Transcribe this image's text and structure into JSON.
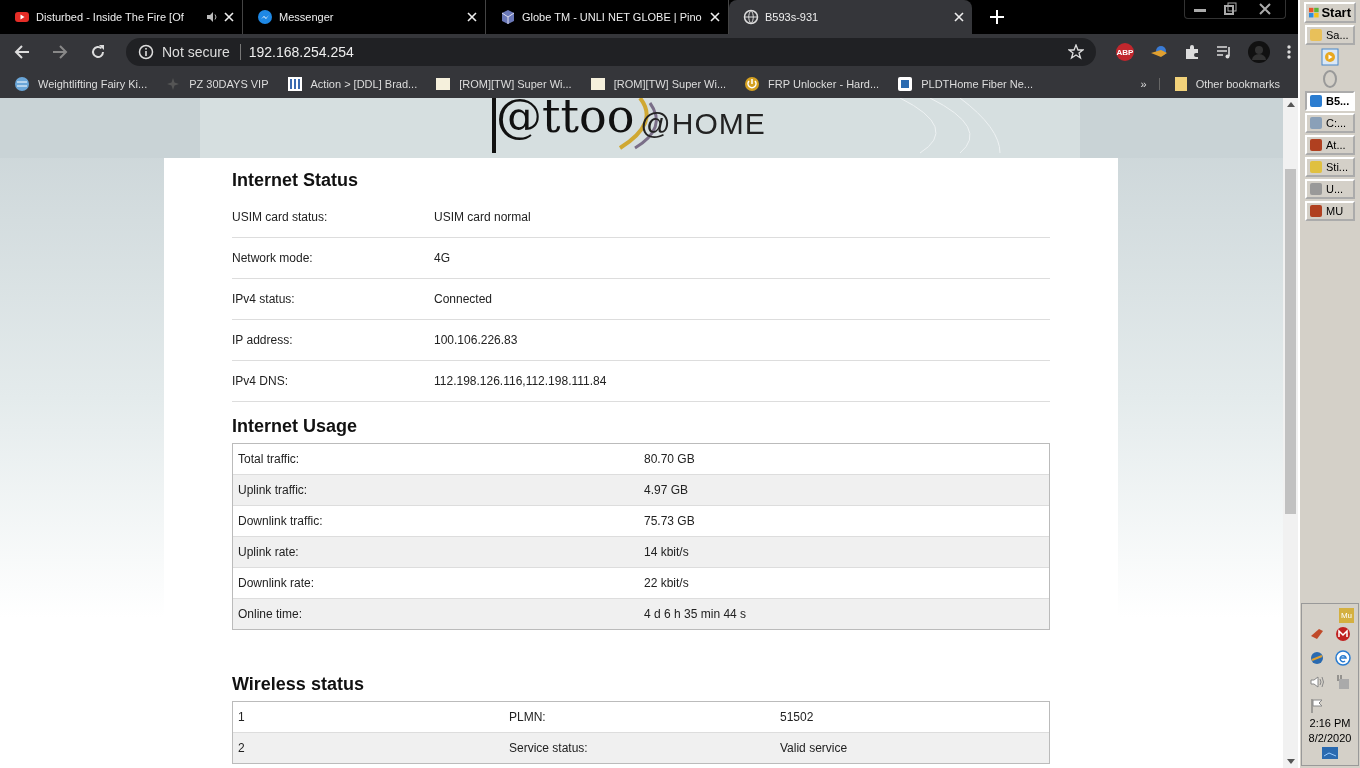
{
  "browser": {
    "tabs": [
      {
        "title": "Disturbed - Inside The Fire [Of",
        "audio": true,
        "selected": false
      },
      {
        "title": "Messenger",
        "audio": false,
        "selected": false
      },
      {
        "title": "Globe TM - UNLI NET GLOBE | Pino",
        "audio": false,
        "selected": false
      },
      {
        "title": "B593s-931",
        "audio": false,
        "selected": true
      }
    ],
    "security": "Not secure",
    "address": "192.168.254.254",
    "extensions": [
      {
        "label": "ABP"
      }
    ],
    "bookmarks": [
      {
        "title": "Weightlifting Fairy Ki..."
      },
      {
        "title": "PZ 30DAYS VIP"
      },
      {
        "title": "Action > [DDL] Brad..."
      },
      {
        "title": "[ROM][TW] Super Wi..."
      },
      {
        "title": "[ROM][TW] Super Wi..."
      },
      {
        "title": "FRP Unlocker - Hard..."
      },
      {
        "title": "PLDTHome Fiber Ne..."
      }
    ],
    "more_bookmarks": "»",
    "other_bookmarks": "Other bookmarks"
  },
  "page": {
    "logo": {
      "brand": "@ttoo",
      "suffix": "@HOME"
    },
    "internet_status": {
      "title": "Internet Status",
      "rows": [
        {
          "label": "USIM card status:",
          "value": "USIM card normal"
        },
        {
          "label": "Network mode:",
          "value": "4G"
        },
        {
          "label": "IPv4 status:",
          "value": "Connected"
        },
        {
          "label": "IP address:",
          "value": "100.106.226.83"
        },
        {
          "label": "IPv4 DNS:",
          "value": "112.198.126.116,112.198.111.84"
        }
      ]
    },
    "internet_usage": {
      "title": "Internet Usage",
      "rows": [
        {
          "label": "Total traffic:",
          "value": "80.70 GB"
        },
        {
          "label": "Uplink traffic:",
          "value": "4.97 GB"
        },
        {
          "label": "Downlink traffic:",
          "value": "75.73 GB"
        },
        {
          "label": "Uplink rate:",
          "value": "14 kbit/s"
        },
        {
          "label": "Downlink rate:",
          "value": "22 kbit/s"
        },
        {
          "label": "Online time:",
          "value": "4 d 6 h 35 min 44 s"
        }
      ]
    },
    "wireless_status": {
      "title": "Wireless status",
      "rows": [
        {
          "index": "1",
          "label": "PLMN:",
          "value": "51502"
        },
        {
          "index": "2",
          "label": "Service status:",
          "value": "Valid service"
        }
      ]
    }
  },
  "taskbar": {
    "start": "Start",
    "tasks": [
      {
        "title": "Sa...",
        "selected": false
      },
      {
        "title": "B5...",
        "selected": true
      },
      {
        "title": "C:...",
        "selected": false
      },
      {
        "title": "At...",
        "selected": false
      },
      {
        "title": "Sti...",
        "selected": false
      },
      {
        "title": "U...",
        "selected": false
      },
      {
        "title": "MU",
        "selected": false
      }
    ],
    "tray_badge": "Mu",
    "time": "2:16 PM",
    "date": "8/2/2020"
  }
}
